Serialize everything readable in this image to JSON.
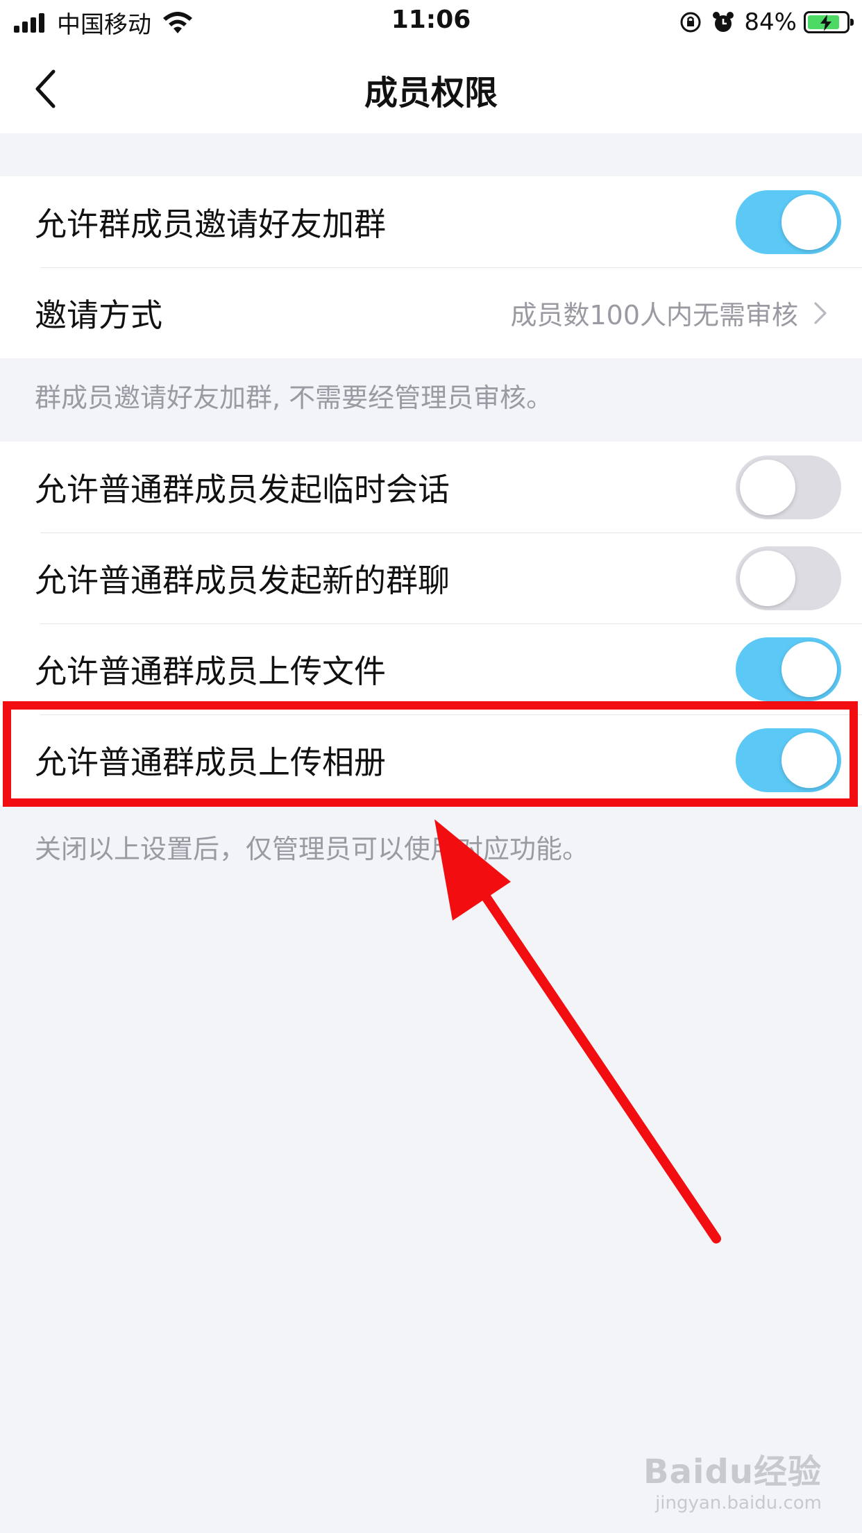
{
  "status_bar": {
    "carrier": "中国移动",
    "time": "11:06",
    "battery_percent": "84%",
    "battery_level": 0.84
  },
  "nav": {
    "back_icon": "chevron-left-icon",
    "title": "成员权限"
  },
  "group1": {
    "rows": [
      {
        "label": "允许群成员邀请好友加群",
        "toggle": true
      },
      {
        "label": "邀请方式",
        "value": "成员数100人内无需审核"
      }
    ],
    "note": "群成员邀请好友加群, 不需要经管理员审核。"
  },
  "group2": {
    "rows": [
      {
        "label": "允许普通群成员发起临时会话",
        "toggle": false
      },
      {
        "label": "允许普通群成员发起新的群聊",
        "toggle": false
      },
      {
        "label": "允许普通群成员上传文件",
        "toggle": true
      },
      {
        "label": "允许普通群成员上传相册",
        "toggle": true
      }
    ],
    "note": "关闭以上设置后，仅管理员可以使用对应功能。"
  },
  "colors": {
    "toggle_on": "#5bc8f5",
    "toggle_off": "#dcdce2",
    "annotation_red": "#f10d10"
  },
  "watermark": {
    "logo": "Baidu经验",
    "url": "jingyan.baidu.com"
  }
}
